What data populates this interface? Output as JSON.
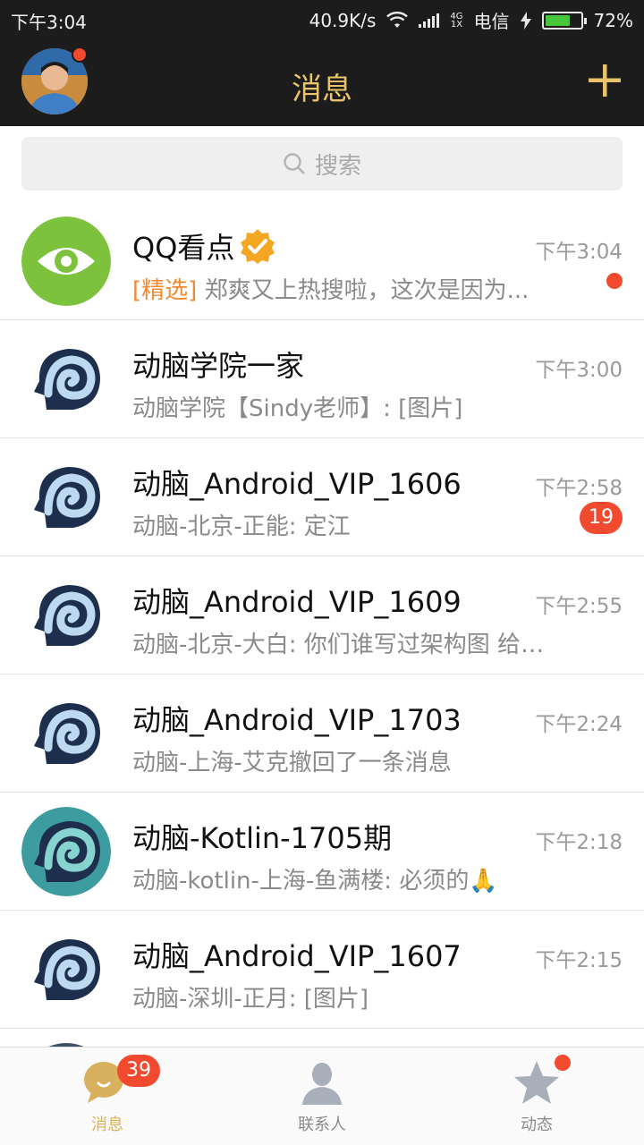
{
  "status_bar": {
    "time": "下午3:04",
    "net_speed": "40.9K/s",
    "net_type_top": "4G",
    "net_type_bottom": "1X",
    "carrier": "电信",
    "battery": "72%",
    "battery_level": 0.72
  },
  "header": {
    "title": "消息"
  },
  "search": {
    "placeholder": "搜索"
  },
  "conversations": [
    {
      "name": "QQ看点",
      "tag": "[精选]",
      "preview": "郑爽又上热搜啦，这次是因为...",
      "time": "下午3:04",
      "unread_dot": true,
      "verified": true,
      "avatar": "eye-logo"
    },
    {
      "name": "动脑学院一家",
      "preview": "动脑学院【Sindy老师】: [图片]",
      "time": "下午3:00",
      "avatar": "brain-logo"
    },
    {
      "name": "动脑_Android_VIP_1606",
      "preview": "动脑-北京-正能: 定江",
      "time": "下午2:58",
      "badge": "19",
      "avatar": "brain-logo"
    },
    {
      "name": "动脑_Android_VIP_1609",
      "preview": "动脑-北京-大白: 你们谁写过架构图 给参...",
      "time": "下午2:55",
      "avatar": "brain-logo"
    },
    {
      "name": "动脑_Android_VIP_1703",
      "preview": "动脑-上海-艾克撤回了一条消息",
      "time": "下午2:24",
      "avatar": "brain-logo"
    },
    {
      "name": "动脑-Kotlin-1705期",
      "preview": "动脑-kotlin-上海-鱼满楼: 必须的🙏",
      "time": "下午2:18",
      "avatar": "brain-logo-teal"
    },
    {
      "name": "动脑_Android_VIP_1607",
      "preview": "动脑-深圳-正月: [图片]",
      "time": "下午2:15",
      "avatar": "brain-logo"
    }
  ],
  "tabs": [
    {
      "label": "消息",
      "badge": "39",
      "icon": "chat-bubble-icon",
      "active": true
    },
    {
      "label": "联系人",
      "icon": "contact-person-icon"
    },
    {
      "label": "动态",
      "icon": "star-icon",
      "dot": true
    }
  ],
  "colors": {
    "accent": "#e3b04c",
    "badge": "#f24a2f",
    "header_bg": "#1c1c1c"
  }
}
